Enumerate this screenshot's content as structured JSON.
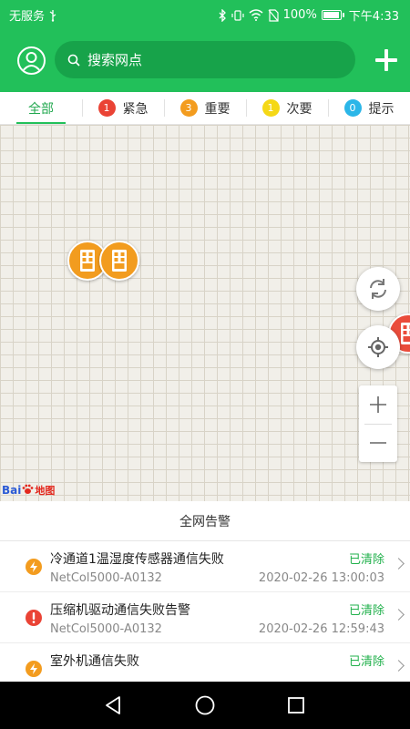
{
  "status_bar": {
    "carrier": "无服务",
    "battery": "100%",
    "battery_level": 1.0,
    "time": "下午4:33"
  },
  "header": {
    "search_placeholder": "搜索网点",
    "profile_icon": "user-icon",
    "add_icon": "plus-icon"
  },
  "tabs": [
    {
      "label": "全部",
      "active": true
    },
    {
      "label": "紧急",
      "count": "1",
      "color": "#ea4335"
    },
    {
      "label": "重要",
      "count": "3",
      "color": "#f39c1f"
    },
    {
      "label": "次要",
      "count": "1",
      "color": "#f5d816"
    },
    {
      "label": "提示",
      "count": "0",
      "color": "#2bb6e8"
    }
  ],
  "map": {
    "logo_prefix": "Bai",
    "logo_suffix": "地图",
    "controls": [
      "refresh-icon",
      "locate-icon",
      "zoom-in-icon",
      "zoom-out-icon"
    ]
  },
  "alarms": {
    "title": "全网告警",
    "items": [
      {
        "title": "冷通道1温湿度传感器通信失败",
        "device": "NetCol5000-A0132",
        "status": "已清除",
        "time": "2020-02-26 13:00:03",
        "severity": "important",
        "icon": "lightning-icon",
        "color": "#f39c1f"
      },
      {
        "title": "压缩机驱动通信失败告警",
        "device": "NetCol5000-A0132",
        "status": "已清除",
        "time": "2020-02-26 12:59:43",
        "severity": "urgent",
        "icon": "exclamation-icon",
        "color": "#ea4335"
      },
      {
        "title": "室外机通信失败",
        "device": "",
        "status": "已清除",
        "time": "",
        "severity": "important",
        "icon": "lightning-icon",
        "color": "#f39c1f"
      }
    ]
  },
  "nav": [
    "back-icon",
    "home-icon",
    "recents-icon"
  ]
}
